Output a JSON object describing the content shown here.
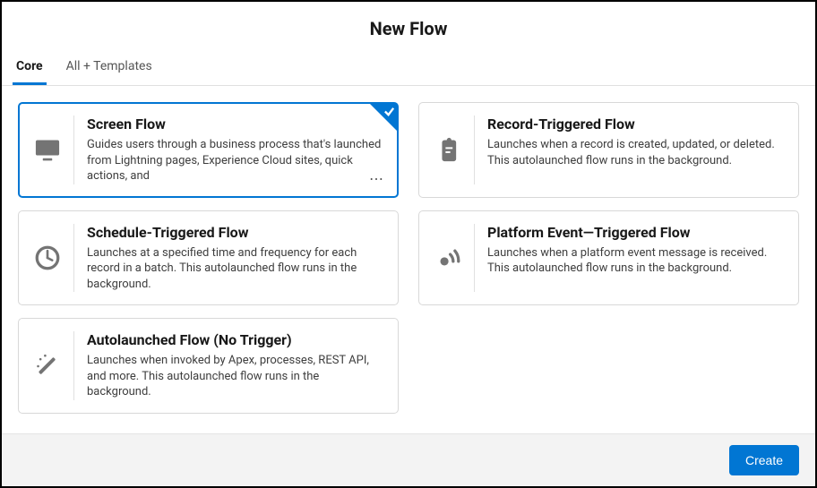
{
  "header": {
    "title": "New Flow"
  },
  "tabs": {
    "core": "Core",
    "all": "All + Templates"
  },
  "cards": {
    "screen": {
      "title": "Screen Flow",
      "desc": "Guides users through a business process that's launched from Lightning pages, Experience Cloud sites, quick actions, and"
    },
    "record": {
      "title": "Record-Triggered Flow",
      "desc": "Launches when a record is created, updated, or deleted. This autolaunched flow runs in the background."
    },
    "schedule": {
      "title": "Schedule-Triggered Flow",
      "desc": "Launches at a specified time and frequency for each record in a batch. This autolaunched flow runs in the background."
    },
    "platform": {
      "title": "Platform Event—Triggered Flow",
      "desc": "Launches when a platform event message is received. This autolaunched flow runs in the background."
    },
    "auto": {
      "title": "Autolaunched Flow (No Trigger)",
      "desc": "Launches when invoked by Apex, processes, REST API, and more. This autolaunched flow runs in the background."
    }
  },
  "footer": {
    "create": "Create"
  }
}
